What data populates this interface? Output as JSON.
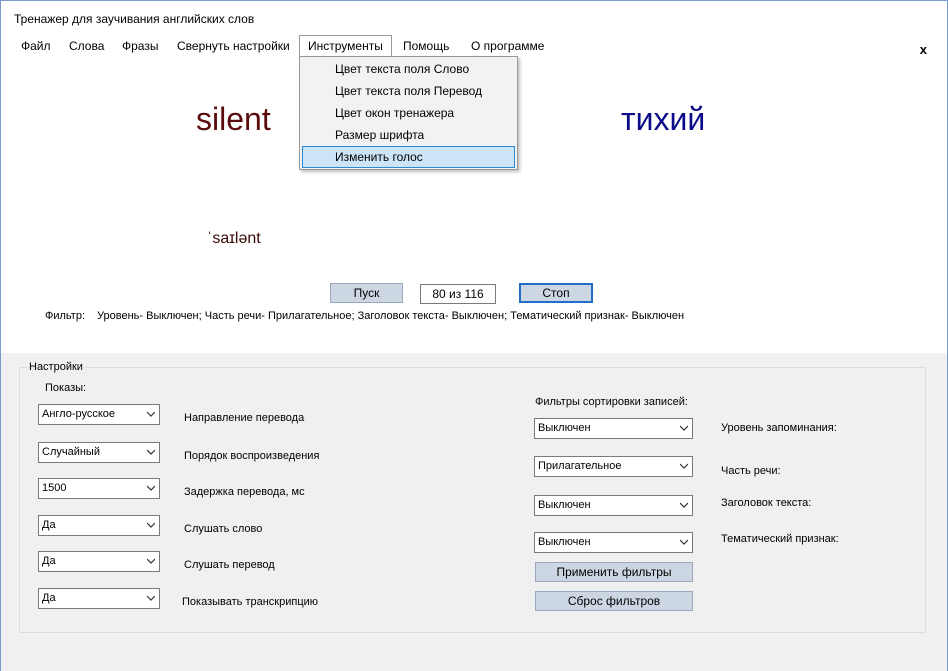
{
  "window": {
    "title": "Тренажер для заучивания английских слов"
  },
  "menu": {
    "items": [
      {
        "id": "file",
        "label": "Файл"
      },
      {
        "id": "words",
        "label": "Слова"
      },
      {
        "id": "phrases",
        "label": "Фразы"
      },
      {
        "id": "collapse",
        "label": "Свернуть настройки"
      },
      {
        "id": "tools",
        "label": "Инструменты"
      },
      {
        "id": "help",
        "label": "Помощь"
      },
      {
        "id": "about",
        "label": "О программе"
      }
    ],
    "close": "x"
  },
  "tools_menu": {
    "items": [
      "Цвет текста поля Слово",
      "Цвет текста поля Перевод",
      "Цвет окон тренажера",
      "Размер шрифта",
      "Изменить голос"
    ],
    "highlighted_index": 4
  },
  "trainer": {
    "word": "silent",
    "translation": "тихий",
    "transcription": "ˈsaɪlənt",
    "word_color": "#5a0c0c",
    "translation_color": "#0b0b8a",
    "start_label": "Пуск",
    "counter": "80 из 116",
    "stop_label": "Стоп"
  },
  "filter_status": {
    "label": "Фильтр:",
    "text": "Уровень- Выключен; Часть речи- Прилагательное; Заголовок текста- Выключен; Тематический признак- Выключен"
  },
  "settings": {
    "title": "Настройки",
    "shows_label": "Показы:",
    "rows": [
      {
        "value": "Англо-русское",
        "label": "Направление перевода"
      },
      {
        "value": "Случайный",
        "label": "Порядок воспроизведения"
      },
      {
        "value": "1500",
        "label": "Задержка перевода, мс"
      },
      {
        "value": "Да",
        "label": "Слушать слово"
      },
      {
        "value": "Да",
        "label": "Слушать перевод"
      },
      {
        "value": "Да",
        "label": "Показывать транскрипцию"
      }
    ],
    "filters_title": "Фильтры сортировки записей:",
    "filters": [
      {
        "value": "Выключен",
        "label": "Уровень запоминания:"
      },
      {
        "value": "Прилагательное",
        "label": "Часть речи:"
      },
      {
        "value": "Выключен",
        "label": "Заголовок текста:"
      },
      {
        "value": "Выключен",
        "label": "Тематический признак:"
      }
    ],
    "apply_label": "Применить фильтры",
    "reset_label": "Сброс фильтров"
  }
}
